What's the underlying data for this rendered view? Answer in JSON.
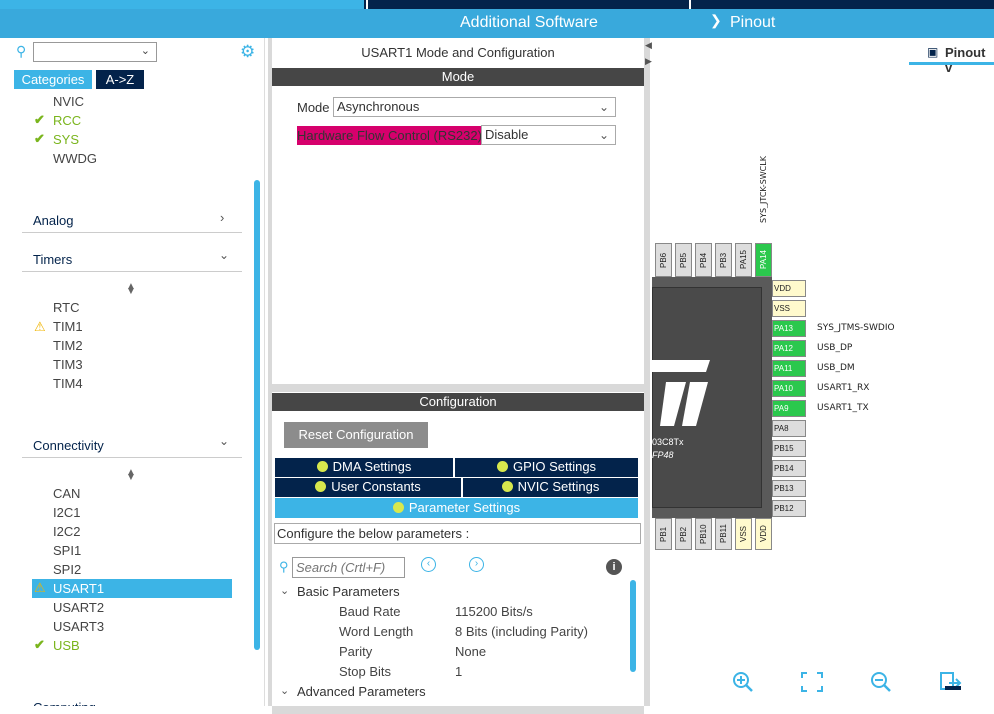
{
  "topnav": {
    "additional_software": "Additional Software",
    "pinout": "Pinout"
  },
  "left": {
    "tab_categories": "Categories",
    "tab_az": "A->Z",
    "system_items": [
      {
        "label": "NVIC",
        "status": "none"
      },
      {
        "label": "RCC",
        "status": "ok"
      },
      {
        "label": "SYS",
        "status": "ok"
      },
      {
        "label": "WWDG",
        "status": "none"
      }
    ],
    "sections": {
      "analog": "Analog",
      "timers": "Timers",
      "connectivity": "Connectivity",
      "computing": "Computing"
    },
    "timer_items": [
      {
        "label": "RTC",
        "status": "none"
      },
      {
        "label": "TIM1",
        "status": "warn"
      },
      {
        "label": "TIM2",
        "status": "none"
      },
      {
        "label": "TIM3",
        "status": "none"
      },
      {
        "label": "TIM4",
        "status": "none"
      }
    ],
    "connectivity_items": [
      {
        "label": "CAN",
        "status": "none"
      },
      {
        "label": "I2C1",
        "status": "none"
      },
      {
        "label": "I2C2",
        "status": "none"
      },
      {
        "label": "SPI1",
        "status": "none"
      },
      {
        "label": "SPI2",
        "status": "none"
      },
      {
        "label": "USART1",
        "status": "warn"
      },
      {
        "label": "USART2",
        "status": "none"
      },
      {
        "label": "USART3",
        "status": "none"
      },
      {
        "label": "USB",
        "status": "ok"
      }
    ]
  },
  "mid": {
    "title": "USART1 Mode and Configuration",
    "mode_header": "Mode",
    "mode_label": "Mode",
    "mode_value": "Asynchronous",
    "hfc_label": "Hardware Flow Control (RS232)",
    "hfc_value": "Disable",
    "config_header": "Configuration",
    "reset_button": "Reset Configuration",
    "tabs": {
      "dma": "DMA Settings",
      "gpio": "GPIO Settings",
      "user_constants": "User Constants",
      "nvic": "NVIC Settings",
      "parameter": "Parameter Settings"
    },
    "configure_text": "Configure the below parameters :",
    "search_placeholder": "Search (Crtl+F)",
    "basic_params": "Basic Parameters",
    "params": [
      {
        "name": "Baud Rate",
        "value": "115200 Bits/s"
      },
      {
        "name": "Word Length",
        "value": "8 Bits (including Parity)"
      },
      {
        "name": "Parity",
        "value": "None"
      },
      {
        "name": "Stop Bits",
        "value": "1"
      }
    ],
    "advanced_params": "Advanced Parameters"
  },
  "right": {
    "pinout_view": "Pinout v",
    "top_pins": [
      "PB6",
      "PB5",
      "PB4",
      "PB3",
      "PA15",
      "PA14"
    ],
    "top_pin_label": "SYS_JTCK-SWCLK",
    "right_pins": [
      {
        "name": "VDD",
        "label": ""
      },
      {
        "name": "VSS",
        "label": ""
      },
      {
        "name": "PA13",
        "label": "SYS_JTMS-SWDIO"
      },
      {
        "name": "PA12",
        "label": "USB_DP"
      },
      {
        "name": "PA11",
        "label": "USB_DM"
      },
      {
        "name": "PA10",
        "label": "USART1_RX"
      },
      {
        "name": "PA9",
        "label": "USART1_TX"
      },
      {
        "name": "PA8",
        "label": ""
      },
      {
        "name": "PB15",
        "label": ""
      },
      {
        "name": "PB14",
        "label": ""
      },
      {
        "name": "PB13",
        "label": ""
      },
      {
        "name": "PB12",
        "label": ""
      }
    ],
    "bottom_pins": [
      "PB1",
      "PB2",
      "PB10",
      "PB11",
      "VSS",
      "VDD"
    ],
    "chip_text1": "03C8Tx",
    "chip_text2": "FP48"
  }
}
